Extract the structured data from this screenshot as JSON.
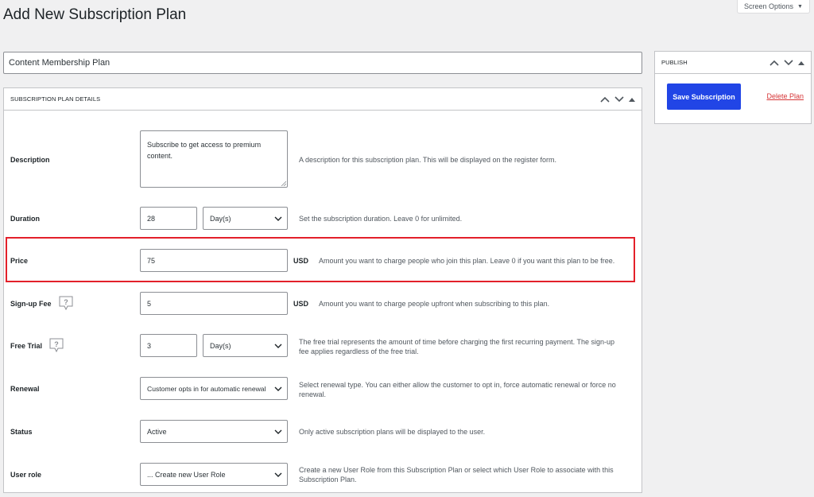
{
  "page": {
    "title": "Add New Subscription Plan",
    "screen_options": "Screen Options"
  },
  "plan_name": "Content Membership Plan",
  "details": {
    "title": "SUBSCRIPTION PLAN DETAILS",
    "description": {
      "label": "Description",
      "value": "Subscribe to get access to premium content.",
      "help": "A description for this subscription plan. This will be displayed on the register form."
    },
    "duration": {
      "label": "Duration",
      "value": "28",
      "unit": "Day(s)",
      "help": "Set the subscription duration. Leave 0 for unlimited."
    },
    "price": {
      "label": "Price",
      "value": "75",
      "currency": "USD",
      "help": "Amount you want to charge people who join this plan. Leave 0 if you want this plan to be free."
    },
    "signup_fee": {
      "label": "Sign-up Fee",
      "value": "5",
      "currency": "USD",
      "help": "Amount you want to charge people upfront when subscribing to this plan."
    },
    "free_trial": {
      "label": "Free Trial",
      "value": "3",
      "unit": "Day(s)",
      "help_line1": "The free trial represents the amount of time before charging the first recurring payment. The sign-up",
      "help_line2": "fee applies regardless of the free trial."
    },
    "renewal": {
      "label": "Renewal",
      "value": "Customer opts in for automatic renewal",
      "help_line1": "Select renewal type. You can either allow the customer to opt in, force automatic renewal or force no",
      "help_line2": "renewal."
    },
    "status": {
      "label": "Status",
      "value": "Active",
      "help": "Only active subscription plans will be displayed to the user."
    },
    "user_role": {
      "label": "User role",
      "value": "... Create new User Role",
      "help_line1": "Create a new User Role from this Subscription Plan or select which User Role to associate with this",
      "help_line2": "Subscription Plan."
    }
  },
  "publish": {
    "title": "PUBLISH",
    "save_label": "Save Subscription",
    "delete_label": "Delete Plan"
  },
  "colors": {
    "primary_button": "#2145e6",
    "delete_link": "#d63638",
    "highlight": "#e3202a"
  }
}
